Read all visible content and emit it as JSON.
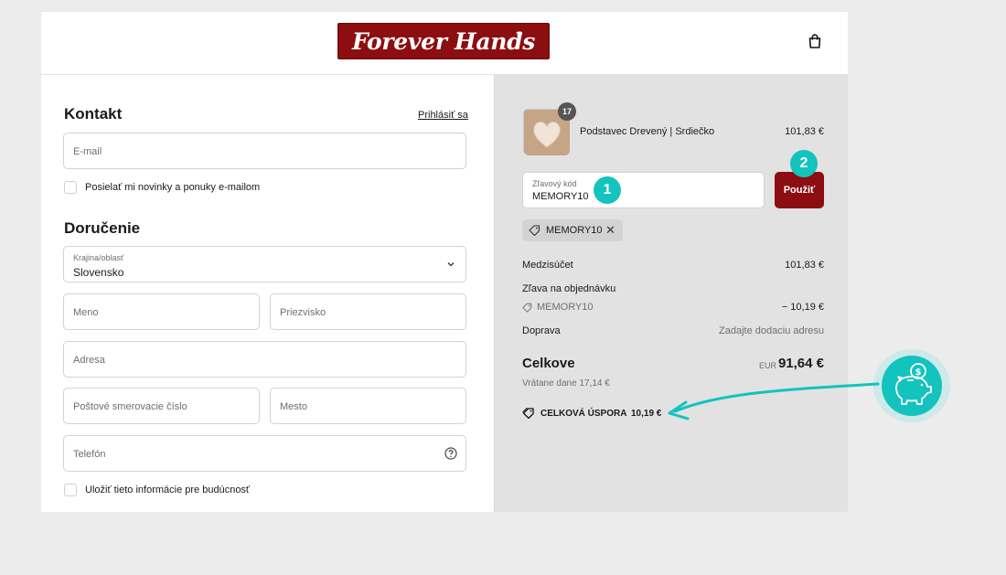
{
  "header": {
    "logo_text": "Forever Hands",
    "logo_mark": "®",
    "cart_icon": "shopping-bag-icon"
  },
  "contact": {
    "title": "Kontakt",
    "login_link": "Prihlásiť sa",
    "email_placeholder": "E-mail",
    "newsletter_label": "Posielať mi novinky a ponuky e-mailom"
  },
  "delivery": {
    "title": "Doručenie",
    "country_label": "Krajina/oblasť",
    "country_value": "Slovensko",
    "first_name_placeholder": "Meno",
    "last_name_placeholder": "Priezvisko",
    "address_placeholder": "Adresa",
    "postal_placeholder": "Poštové smerovacie číslo",
    "city_placeholder": "Mesto",
    "phone_placeholder": "Telefón",
    "save_info_label": "Uložiť tieto informácie pre budúcnosť"
  },
  "summary": {
    "product_qty_badge": "17",
    "product_name": "Podstavec Drevený | Srdiečko",
    "product_price": "101,83 €",
    "discount_label": "Zľavový kód",
    "discount_value": "MEMORY10",
    "apply_button": "Použiť",
    "applied_code": "MEMORY10",
    "subtotal_label": "Medzisúčet",
    "subtotal_value": "101,83 €",
    "order_discount_label": "Zľava na objednávku",
    "order_discount_code": "MEMORY10",
    "order_discount_value": "− 10,19 €",
    "shipping_label": "Doprava",
    "shipping_value": "Zadajte dodaciu adresu",
    "total_label": "Celkove",
    "total_currency": "EUR",
    "total_value": "91,64 €",
    "tax_note": "Vrátane dane 17,14 €",
    "savings_label": "CELKOVÁ ÚSPORA",
    "savings_value": "10,19 €"
  },
  "annotations": {
    "step1": "1",
    "step2": "2"
  },
  "colors": {
    "brand": "#8c0e10",
    "accent": "#12c3be",
    "panel": "#e2e2e2"
  }
}
